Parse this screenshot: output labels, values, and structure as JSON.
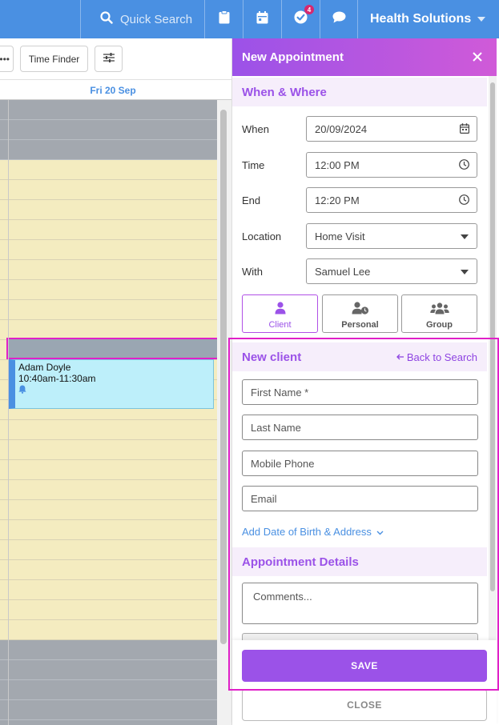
{
  "topbar": {
    "search_label": "Quick Search",
    "icons": [
      "search-icon",
      "clipboard-icon",
      "calendar-icon",
      "check-circle-icon",
      "chat-icon"
    ],
    "tasks_badge": "4",
    "org_name": "Health Solutions"
  },
  "toolbar": {
    "more_label": "•••",
    "time_finder_label": "Time Finder",
    "filter_icon": "sliders-icon"
  },
  "calendar": {
    "day_header": "Fri 20 Sep",
    "appointment": {
      "client": "Adam Doyle",
      "time": "10:40am-11:30am",
      "reminder_icon": "bell-icon"
    }
  },
  "panel": {
    "title": "New Appointment",
    "close_icon": "close-icon",
    "when_where": {
      "heading": "When & Where",
      "when_label": "When",
      "when_value": "20/09/2024",
      "time_label": "Time",
      "time_value": "12:00 PM",
      "end_label": "End",
      "end_value": "12:20 PM",
      "location_label": "Location",
      "location_value": "Home Visit",
      "with_label": "With",
      "with_value": "Samuel Lee"
    },
    "types": [
      {
        "label": "Client",
        "icon": "person-icon"
      },
      {
        "label": "Personal",
        "icon": "person-clock-icon"
      },
      {
        "label": "Group",
        "icon": "group-icon"
      }
    ],
    "new_client": {
      "heading": "New client",
      "back_link": "Back to Search",
      "first_name_placeholder": "First Name *",
      "last_name_placeholder": "Last Name",
      "mobile_placeholder": "Mobile Phone",
      "email_placeholder": "Email",
      "add_dob_link": "Add Date of Birth & Address"
    },
    "details": {
      "heading": "Appointment Details",
      "comments_placeholder": "Comments..."
    },
    "footer": {
      "save_label": "SAVE",
      "close_label": "CLOSE"
    }
  },
  "colors": {
    "topbar": "#4a90e2",
    "accent": "#9b52e8",
    "calendar_available": "#f4ecc0",
    "calendar_unavailable": "#a3a8af",
    "appointment": "#bdeffa",
    "highlight": "#e020c8"
  }
}
